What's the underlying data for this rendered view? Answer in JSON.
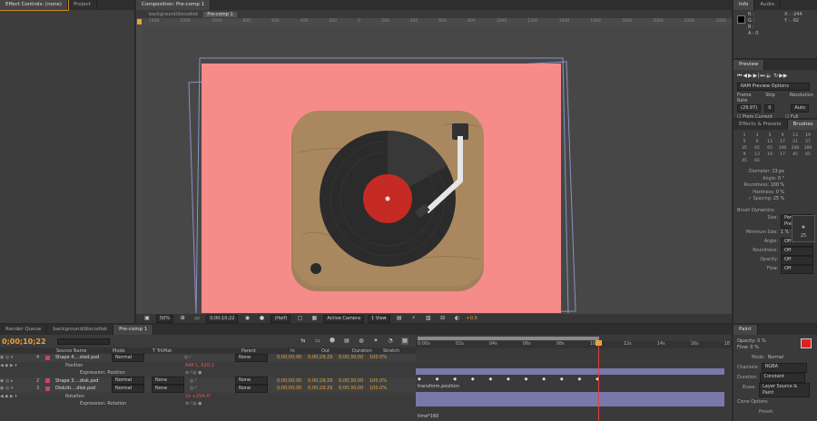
{
  "left_panel": {
    "tabs": [
      "Effect Controls: (none)",
      "Project"
    ]
  },
  "comp_panel": {
    "tabs": [
      "Composition: Pre-comp 1"
    ],
    "breadcrumbs": [
      "background/discodisk",
      "Pre-comp 1"
    ],
    "ruler_ticks": [
      "1400",
      "1200",
      "1000",
      "800",
      "600",
      "400",
      "200",
      "0",
      "200",
      "400",
      "600",
      "800",
      "1000",
      "1200",
      "1400",
      "1600",
      "1800",
      "2000",
      "2200",
      "2400"
    ],
    "footer": {
      "zoom": "50%",
      "timecode": "0;00;10;22",
      "resolution": "(Half)",
      "camera": "Active Camera",
      "views": "1 View",
      "exposure": "+0.0"
    },
    "colors": {
      "background": "#f58c89",
      "wood": "#a0805a",
      "record": "#2b2b2b",
      "label": "#c62a24"
    }
  },
  "info_panel": {
    "tabs": [
      "Info",
      "Audio"
    ],
    "rgba": [
      "R :",
      "G :",
      "B :",
      "A : 0"
    ],
    "x": "X : -244",
    "y": "Y : -92"
  },
  "preview_panel": {
    "tabs": [
      "Preview"
    ],
    "ram_options": "RAM Preview Options",
    "headers": [
      "Frame Rate",
      "Skip",
      "Resolution"
    ],
    "values": [
      "(29.97)",
      "0",
      "Auto"
    ],
    "from_current": "From Current Time",
    "full_screen": "Full Screen"
  },
  "brushes_panel": {
    "tabs": [
      "Effects & Presets",
      "Brushes"
    ],
    "sizes": [
      "1",
      "3",
      "5",
      "9",
      "13",
      "19",
      "5",
      "9",
      "13",
      "17",
      "21",
      "27",
      "35",
      "45",
      "65",
      "100",
      "200",
      "300",
      "9",
      "13",
      "19",
      "17",
      "45",
      "65",
      "45",
      "65"
    ],
    "props": [
      {
        "label": "Diameter:",
        "value": "13 px"
      },
      {
        "label": "Angle:",
        "value": "0 °"
      },
      {
        "label": "Roundness:",
        "value": "100 %"
      },
      {
        "label": "Hardness:",
        "value": "0 %"
      },
      {
        "label": "✓ Spacing:",
        "value": "25 %"
      }
    ],
    "preview_num": "25",
    "dynamics_title": "Brush Dynamics",
    "dynamics": [
      {
        "label": "Size:",
        "value": "Pen Pressure"
      },
      {
        "label": "Minimum Size:",
        "value": "1 %"
      },
      {
        "label": "Angle:",
        "value": "Off"
      },
      {
        "label": "Roundness:",
        "value": "Off"
      },
      {
        "label": "Opacity:",
        "value": "Off"
      },
      {
        "label": "Flow:",
        "value": "Off"
      }
    ]
  },
  "paint_panel": {
    "tabs": [
      "Paint"
    ],
    "opacity": "Opacity: 0 %",
    "flow": "Flow: 0 %",
    "mode": {
      "label": "Mode:",
      "value": "Normal"
    },
    "channels": {
      "label": "Channels:",
      "value": "RGBA"
    },
    "duration": {
      "label": "Duration:",
      "value": "Constant"
    },
    "erase": {
      "label": "Erase:",
      "value": "Layer Source & Paint"
    },
    "clone": "Clone Options",
    "preset": "Preset:",
    "color": "#e02020"
  },
  "timeline": {
    "tabs": [
      "Render Queue",
      "background/discodisk",
      "Pre-comp 1"
    ],
    "timecode": "0;00;10;22",
    "headers": [
      "Source Name",
      "Mode",
      "T TrkMat",
      "Parent",
      "In",
      "Out",
      "Duration",
      "Stretch"
    ],
    "time_ticks": [
      "0:00s",
      "02s",
      "04s",
      "06s",
      "08s",
      "10s",
      "12s",
      "14s",
      "16s",
      "18"
    ],
    "layers": [
      {
        "num": "4",
        "name": "Shape 4....sted.psd",
        "mode": "Normal",
        "trkmat": "",
        "parent": "None",
        "in": "0;00;00;00",
        "out": "0;00;29;29",
        "dur": "0;00;30;00",
        "stretch": "100.0%"
      },
      {
        "prop": "Position",
        "value": "848.1, 620.1"
      },
      {
        "expr": "Expression: Position"
      },
      {
        "num": "2",
        "name": "Shape 3....disk.psd",
        "mode": "Normal",
        "trkmat": "None",
        "parent": "None",
        "in": "0;00;00;00",
        "out": "0;00;29;29",
        "dur": "0;00;30;00",
        "stretch": "100.0%"
      },
      {
        "num": "3",
        "name": "Disk/di....disk.psd",
        "mode": "Normal",
        "trkmat": "None",
        "parent": "None",
        "in": "0;00;00;00",
        "out": "0;00;29;29",
        "dur": "0;00;30;00",
        "stretch": "100.0%"
      },
      {
        "prop": "Rotation",
        "value": "2x +254.4°"
      },
      {
        "expr": "Expression: Rotation"
      }
    ],
    "expr_texts": [
      "transform.position",
      "time*160"
    ]
  }
}
